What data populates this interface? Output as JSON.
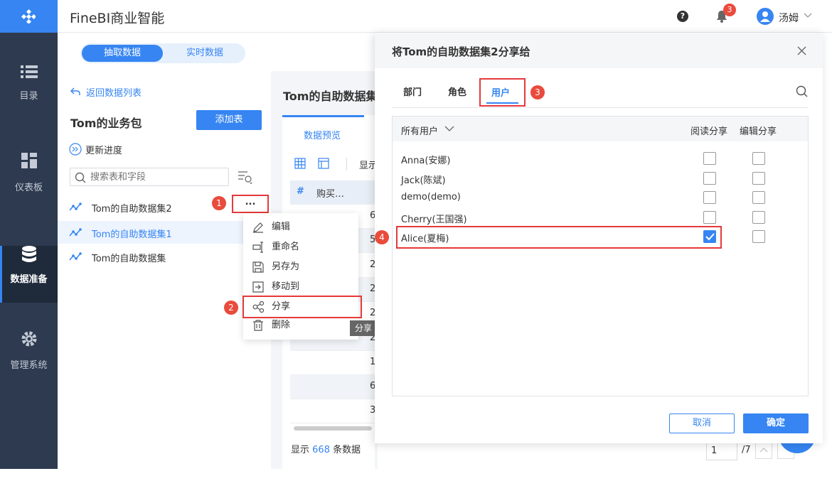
{
  "app": {
    "title": "FineBI商业智能",
    "notification_count": "3",
    "user_name": "汤姆"
  },
  "sidebar": {
    "items": [
      {
        "label": "目录"
      },
      {
        "label": "仪表板"
      },
      {
        "label": "数据准备"
      },
      {
        "label": "管理系统"
      }
    ]
  },
  "tabs": {
    "extract": "抽取数据",
    "realtime": "实时数据"
  },
  "left": {
    "back": "返回数据列表",
    "package_title": "Tom的业务包",
    "add_table": "添加表",
    "update_progress": "更新进度",
    "search_placeholder": "搜索表和字段",
    "datasets": [
      {
        "name": "Tom的自助数据集2"
      },
      {
        "name": "Tom的自助数据集1"
      },
      {
        "name": "Tom的自助数据集"
      }
    ],
    "more": "..."
  },
  "context_menu": {
    "items": [
      {
        "label": "编辑"
      },
      {
        "label": "重命名"
      },
      {
        "label": "另存为"
      },
      {
        "label": "移动到"
      },
      {
        "label": "分享"
      },
      {
        "label": "删除"
      }
    ],
    "tooltip": "分享"
  },
  "steps": [
    "1",
    "2",
    "3",
    "4"
  ],
  "preview": {
    "title": "Tom的自助数据集",
    "tab": "数据预览",
    "show_prefix": "显示",
    "col_header": "购买…",
    "hash": "#",
    "values": [
      "6",
      "5",
      "2",
      "2",
      "2",
      "2",
      "1",
      "6",
      "3"
    ],
    "footer": {
      "prefix": "显示",
      "count": "668",
      "suffix": "条数据"
    },
    "pager": {
      "page": "1",
      "total": "/7"
    }
  },
  "dialog": {
    "title": "将Tom的自助数据集2分享给",
    "tabs": [
      "部门",
      "角色",
      "用户"
    ],
    "col_users": "所有用户",
    "col_read": "阅读分享",
    "col_edit": "编辑分享",
    "users": [
      {
        "name": "Anna(安娜)",
        "read": false,
        "edit": false
      },
      {
        "name": "Jack(陈斌)",
        "read": false,
        "edit": false
      },
      {
        "name": "demo(demo)",
        "read": false,
        "edit": false
      },
      {
        "name": "Cherry(王国强)",
        "read": false,
        "edit": false
      },
      {
        "name": "Alice(夏梅)",
        "read": true,
        "edit": false
      }
    ],
    "cancel": "取消",
    "ok": "确定"
  }
}
